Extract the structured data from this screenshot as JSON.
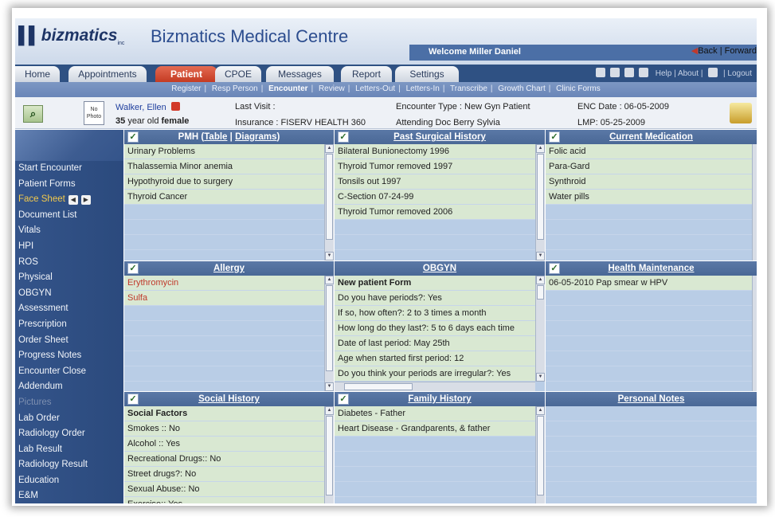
{
  "brand": {
    "logo": "bizmatics",
    "logo_suffix": "inc",
    "app_title": "Bizmatics Medical Centre"
  },
  "welcome": "Welcome Miller Daniel",
  "nav_back_forward": "Back | Forward",
  "tabs": [
    {
      "label": "Home",
      "active": false
    },
    {
      "label": "Appointments",
      "active": false
    },
    {
      "label": "Patient",
      "active": true
    },
    {
      "label": "CPOE",
      "active": false
    },
    {
      "label": "Messages",
      "active": false
    },
    {
      "label": "Report",
      "active": false
    },
    {
      "label": "Settings",
      "active": false
    }
  ],
  "top_links": {
    "help": "Help",
    "about": "About",
    "logout": "Logout"
  },
  "subnav": [
    {
      "label": "Register",
      "current": false
    },
    {
      "label": "Resp Person",
      "current": false
    },
    {
      "label": "Encounter",
      "current": true
    },
    {
      "label": "Review",
      "current": false
    },
    {
      "label": "Letters-Out",
      "current": false
    },
    {
      "label": "Letters-In",
      "current": false
    },
    {
      "label": "Transcribe",
      "current": false
    },
    {
      "label": "Growth Chart",
      "current": false
    },
    {
      "label": "Clinic Forms",
      "current": false
    }
  ],
  "patient": {
    "photo_label": "No Photo",
    "name": "Walker, Ellen",
    "age_num": "35",
    "age_rest": "year old",
    "sex": "female",
    "last_visit": "Last Visit :",
    "insurance": "Insurance : FISERV HEALTH 360",
    "encounter_type": "Encounter Type : New Gyn Patient",
    "attending_doc": "Attending Doc  Berry Sylvia",
    "enc_date": "ENC Date : 06-05-2009",
    "lmp": "LMP:  05-25-2009"
  },
  "sidebar": {
    "items": [
      {
        "label": "Start Encounter",
        "state": "normal"
      },
      {
        "label": "Patient Forms",
        "state": "normal"
      },
      {
        "label": "Face Sheet",
        "state": "current"
      },
      {
        "label": "Document List",
        "state": "normal"
      },
      {
        "label": "Vitals",
        "state": "normal"
      },
      {
        "label": "HPI",
        "state": "normal"
      },
      {
        "label": "ROS",
        "state": "normal"
      },
      {
        "label": "Physical",
        "state": "normal"
      },
      {
        "label": "OBGYN",
        "state": "normal"
      },
      {
        "label": "Assessment",
        "state": "normal"
      },
      {
        "label": "Prescription",
        "state": "normal"
      },
      {
        "label": "Order Sheet",
        "state": "normal"
      },
      {
        "label": "Progress Notes",
        "state": "normal"
      },
      {
        "label": "Encounter Close",
        "state": "normal"
      },
      {
        "label": "Addendum",
        "state": "normal"
      },
      {
        "label": "Pictures",
        "state": "disabled"
      },
      {
        "label": "Lab Order",
        "state": "normal"
      },
      {
        "label": "Radiology Order",
        "state": "normal"
      },
      {
        "label": "Lab Result",
        "state": "normal"
      },
      {
        "label": "Radiology Result",
        "state": "normal"
      },
      {
        "label": "Education",
        "state": "normal"
      },
      {
        "label": "E&M",
        "state": "normal"
      }
    ]
  },
  "panels": {
    "pmh": {
      "title": "PMH",
      "link_table": "Table",
      "link_diagrams": "Diagrams",
      "rows": [
        "Urinary Problems",
        "Thalassemia Minor anemia",
        "Hypothyroid due to surgery",
        "Thyroid Cancer"
      ]
    },
    "surgical": {
      "title": "Past Surgical History",
      "rows": [
        "Bilateral Bunionectomy 1996",
        "Thyroid Tumor removed 1997",
        "Tonsils out 1997",
        "C-Section 07-24-99",
        "Thyroid Tumor removed 2006"
      ]
    },
    "medication": {
      "title": "Current Medication",
      "rows": [
        "Folic acid",
        "Para-Gard",
        "Synthroid",
        "Water pills"
      ]
    },
    "allergy": {
      "title": "Allergy",
      "rows": [
        "Erythromycin",
        "Sulfa"
      ]
    },
    "obgyn": {
      "title": "OBGYN",
      "rows": [
        "New patient Form",
        "Do you have periods?: Yes",
        "If so, how often?: 2 to 3 times a month",
        "How long do they last?: 5 to 6 days each time",
        "Date of last period: May 25th",
        "Age when started first period: 12",
        "Do you think your periods are irregular?: Yes"
      ]
    },
    "health": {
      "title": "Health Maintenance",
      "rows": [
        "06-05-2010 Pap smear w HPV"
      ]
    },
    "social": {
      "title": "Social History",
      "rows": [
        "Social Factors",
        "Smokes :: No",
        "Alcohol :: Yes",
        "Recreational Drugs:: No",
        "Street drugs?: No",
        "Sexual Abuse:: No",
        "Exercise:: Yes"
      ]
    },
    "family": {
      "title": "Family History",
      "rows": [
        "Diabetes - Father",
        "Heart Disease - Grandparents, & father"
      ]
    },
    "notes": {
      "title": "Personal Notes",
      "rows": []
    }
  }
}
